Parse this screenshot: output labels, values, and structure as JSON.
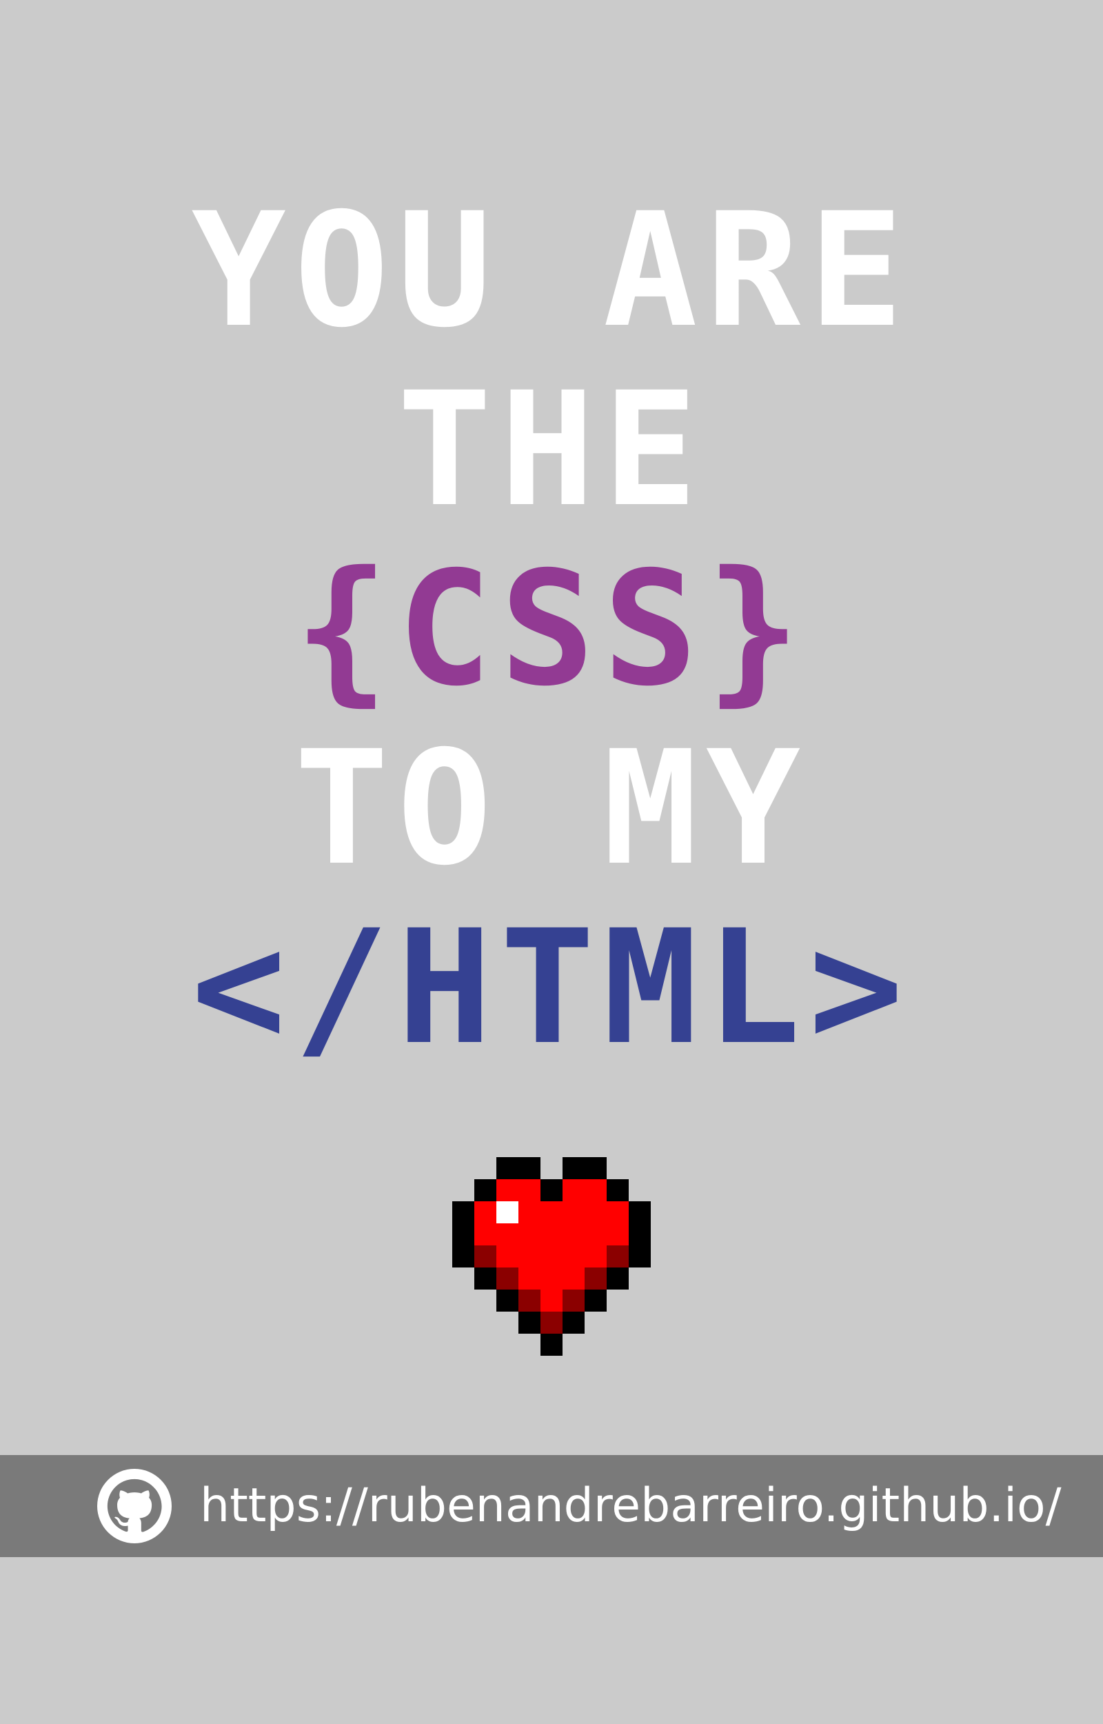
{
  "colors": {
    "background": "#cbcbcb",
    "white_text": "#ffffff",
    "purple_text": "#923a93",
    "blue_text": "#354192",
    "footer_bar": "#7a7a7a",
    "heart_red": "#ff0000",
    "heart_dark_red": "#8b0000",
    "heart_outline": "#000000"
  },
  "poster": {
    "lines": [
      {
        "text": "YOU ARE",
        "color": "#ffffff"
      },
      {
        "text": "THE",
        "color": "#ffffff"
      },
      {
        "text": "{CSS}",
        "color": "#923a93"
      },
      {
        "text": "TO MY",
        "color": "#ffffff"
      },
      {
        "text": "</HTML>",
        "color": "#354192"
      }
    ]
  },
  "heart_icon": "pixel-heart-icon",
  "footer": {
    "icon": "github-icon",
    "url": "https://rubenandrebarreiro.github.io/"
  }
}
